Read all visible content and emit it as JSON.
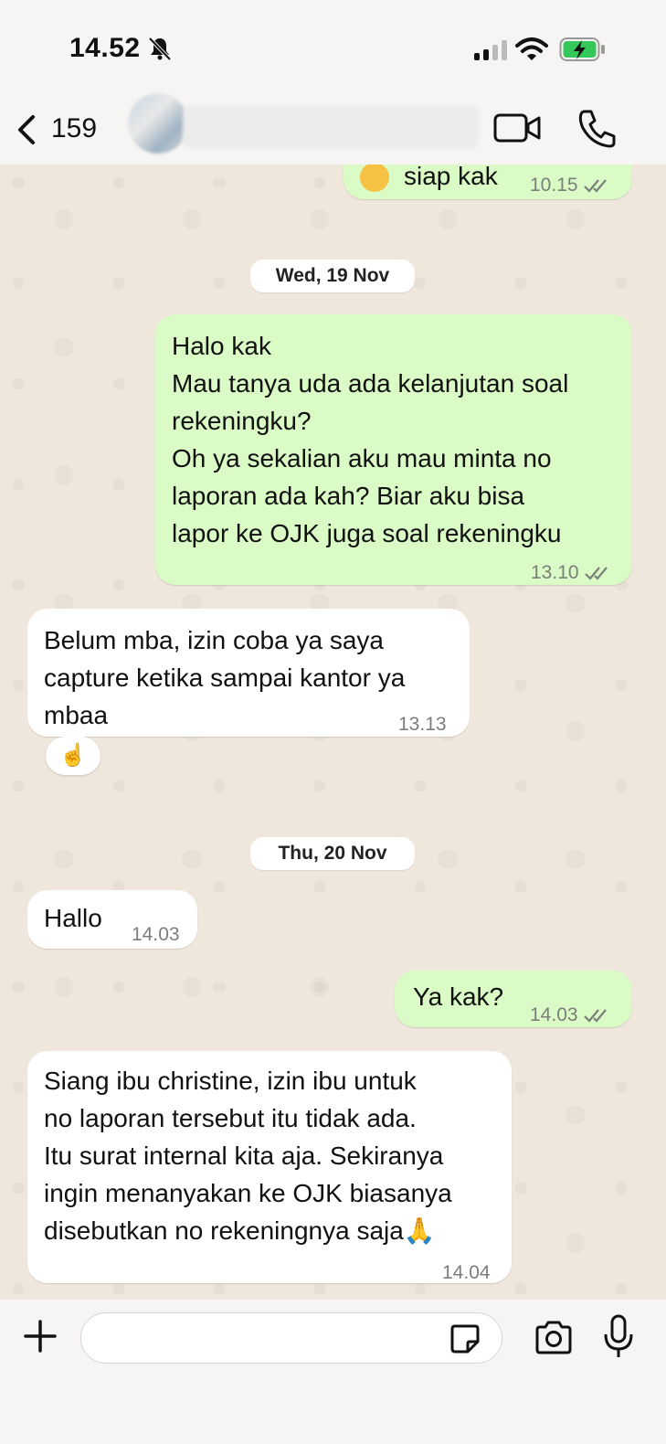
{
  "status_bar": {
    "time": "14.52"
  },
  "header": {
    "unread_count": "159",
    "contact_name": ""
  },
  "messages": [
    {
      "direction": "out",
      "text": "siap kak",
      "time": "10.15",
      "emoji": "sleepy-face"
    },
    {
      "type": "date",
      "label": "Wed, 19 Nov"
    },
    {
      "direction": "out",
      "text": "Halo kak\nMau tanya uda ada kelanjutan soal\nrekeningku?\nOh ya sekalian aku mau minta no\nlaporan ada kah? Biar aku bisa\nlapor ke OJK juga soal rekeningku",
      "time": "13.10"
    },
    {
      "direction": "in",
      "text": "Belum mba, izin coba ya saya\ncapture ketika sampai kantor ya\nmbaa",
      "time": "13.13",
      "reaction": "☝️"
    },
    {
      "type": "date",
      "label": "Thu, 20 Nov"
    },
    {
      "direction": "in",
      "text": "Hallo",
      "time": "14.03"
    },
    {
      "direction": "out",
      "text": "Ya kak?",
      "time": "14.03"
    },
    {
      "direction": "in",
      "text": "Siang ibu christine, izin ibu untuk\nno laporan tersebut itu tidak ada.\nItu surat internal kita aja. Sekiranya\ningin menanyakan ke OJK biasanya\ndisebutkan no rekeningnya saja🙏",
      "time": "14.04"
    }
  ],
  "input": {
    "value": "",
    "placeholder": ""
  },
  "colors": {
    "outgoing_bubble": "#dafbc6",
    "incoming_bubble": "#ffffff",
    "chat_background": "#efe6dc",
    "read_ticks": "#7a7f7a"
  }
}
